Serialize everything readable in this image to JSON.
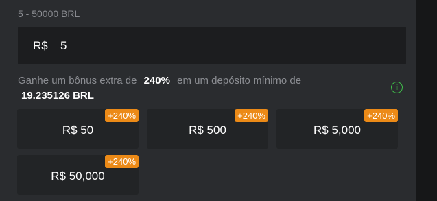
{
  "deposit": {
    "range": "5 - 50000 BRL",
    "currency_symbol": "R$",
    "amount_value": "5",
    "bonus_prefix": "Ganhe um bônus extra de",
    "bonus_percent": "240%",
    "bonus_suffix": "em um depósito mínimo de",
    "min_deposit": "19.235126 BRL",
    "info_icon": "i",
    "chips": [
      {
        "label": "R$ 50",
        "badge": "+240%"
      },
      {
        "label": "R$ 500",
        "badge": "+240%"
      },
      {
        "label": "R$ 5,000",
        "badge": "+240%"
      },
      {
        "label": "R$ 50,000",
        "badge": "+240%"
      }
    ]
  },
  "colors": {
    "accent_badge": "#ec8a17",
    "info_green": "#3fbf4a",
    "panel_bg": "#2a2c2f"
  }
}
